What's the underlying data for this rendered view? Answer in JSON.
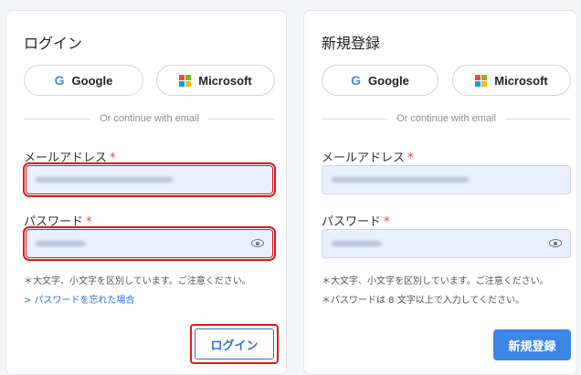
{
  "login": {
    "title": "ログイン",
    "google_label": "Google",
    "microsoft_label": "Microsoft",
    "divider_text": "Or continue with email",
    "email_label": "メールアドレス",
    "password_label": "パスワード",
    "required_mark": "*",
    "case_note": "＊大文字、小文字を区別しています。ご注意ください。",
    "forgot_link": "> パスワードを忘れた場合",
    "submit_label": "ログイン"
  },
  "register": {
    "title": "新規登録",
    "google_label": "Google",
    "microsoft_label": "Microsoft",
    "divider_text": "Or continue with email",
    "email_label": "メールアドレス",
    "password_label": "パスワード",
    "required_mark": "*",
    "case_note": "＊大文字、小文字を区別しています。ご注意ください。",
    "length_note": "＊パスワードは 8 文字以上で入力してください。",
    "submit_label": "新規登録"
  },
  "icons": {
    "google": "google-icon",
    "microsoft": "microsoft-icon",
    "password_toggle": "eye-icon"
  },
  "colors": {
    "accent": "#2f73d6",
    "primary_button": "#3d86e6",
    "required": "#e0443a",
    "highlight": "#dd1a1a",
    "input_bg": "#e8f0fe"
  }
}
